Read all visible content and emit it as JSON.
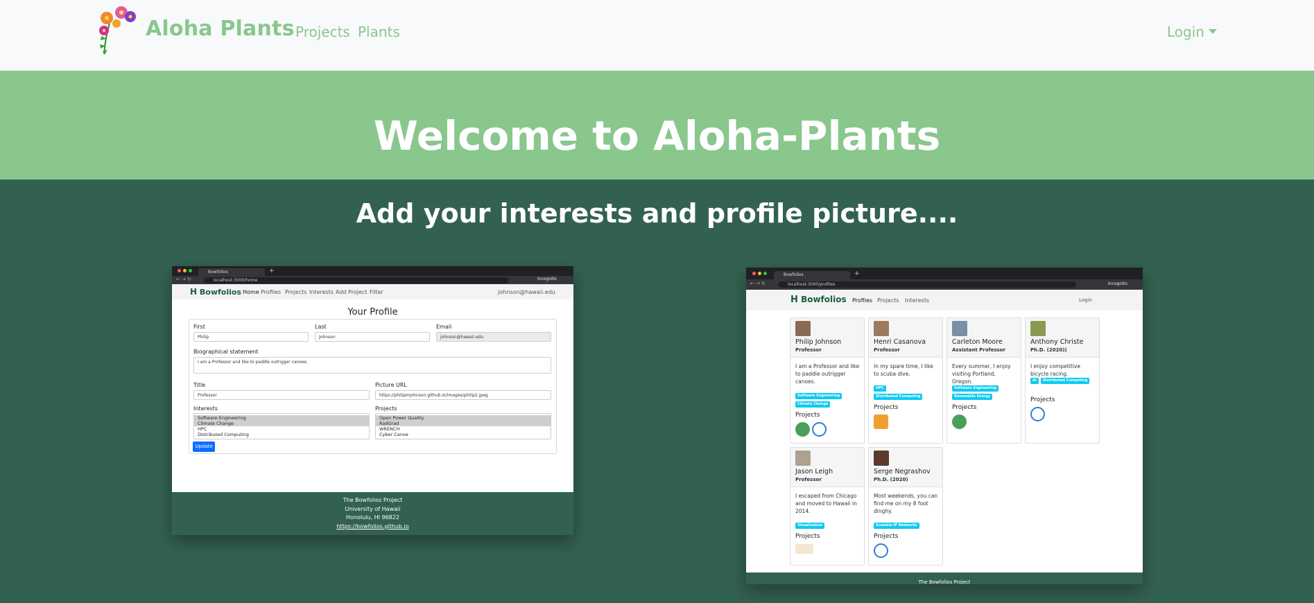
{
  "navbar": {
    "brand": "Aloha Plants",
    "links": [
      "Projects",
      "Plants"
    ],
    "login": "Login"
  },
  "hero": {
    "title": "Welcome to Aloha-Plants"
  },
  "section": {
    "subtitle": "Add your interests and profile picture...."
  },
  "left_screenshot": {
    "tab_title": "Bowfolios",
    "url": "localhost:3000/home",
    "incognito": "Incognito",
    "brand": "Bowfolios",
    "nav": [
      "Home",
      "Profiles",
      "Projects",
      "Interests",
      "Add Project",
      "Filter"
    ],
    "user": "johnson@hawaii.edu",
    "form_title": "Your Profile",
    "first_label": "First",
    "first_value": "Philip",
    "last_label": "Last",
    "last_value": "Johnson",
    "email_label": "Email",
    "email_value": "johnson@hawaii.edu",
    "bio_label": "Biographical statement",
    "bio_value": "I am a Professor and like to paddle outrigger canoes.",
    "title_label": "Title",
    "title_value": "Professor",
    "picture_label": "Picture URL",
    "picture_value": "https://philipmjohnson.github.io/images/philip2.jpeg",
    "interests_label": "Interests",
    "interests": [
      "Software Engineering",
      "Climate Change",
      "HPC",
      "Distributed Computing"
    ],
    "projects_label": "Projects",
    "projects": [
      "Open Power Quality",
      "RadGrad",
      "WRENCH",
      "Cyber Canoe"
    ],
    "update_button": "Update",
    "footer": [
      "The Bowfolios Project",
      "University of Hawaii",
      "Honolulu, HI 96822",
      "https://bowfolios.github.io"
    ]
  },
  "right_screenshot": {
    "tab_title": "Bowfolios",
    "url": "localhost:3000/profiles",
    "incognito": "Incognito",
    "brand": "Bowfolios",
    "nav": [
      "Profiles",
      "Projects",
      "Interests"
    ],
    "login": "Login",
    "projects_heading": "Projects",
    "profiles": [
      {
        "name": "Philip Johnson",
        "title": "Professor",
        "bio": "I am a Professor and like to paddle outrigger canoes.",
        "tags": [
          "Software Engineering",
          "Climate Change"
        ]
      },
      {
        "name": "Henri Casanova",
        "title": "Professor",
        "bio": "In my spare time, I like to scuba dive.",
        "tags": [
          "HPC",
          "Distributed Computing"
        ]
      },
      {
        "name": "Carleton Moore",
        "title": "Assistant Professor",
        "bio": "Every summer, I enjoy visiting Portland, Oregon.",
        "tags": [
          "Software Engineering",
          "Renewable Energy"
        ]
      },
      {
        "name": "Anthony Christe",
        "title": "Ph.D. (2020))",
        "bio": "I enjoy competitive bicycle racing.",
        "tags": [
          "AI",
          "Distributed Computing"
        ]
      },
      {
        "name": "Jason Leigh",
        "title": "Professor",
        "bio": "I escaped from Chicago and moved to Hawaii in 2014.",
        "tags": [
          "Visualization"
        ]
      },
      {
        "name": "Serge Negrashov",
        "title": "Ph.D. (2020)",
        "bio": "Most weekends, you can find me on my 8 foot dinghy.",
        "tags": [
          "Scalable IP Networks"
        ]
      }
    ],
    "footer": "The Bowfolios Project"
  }
}
